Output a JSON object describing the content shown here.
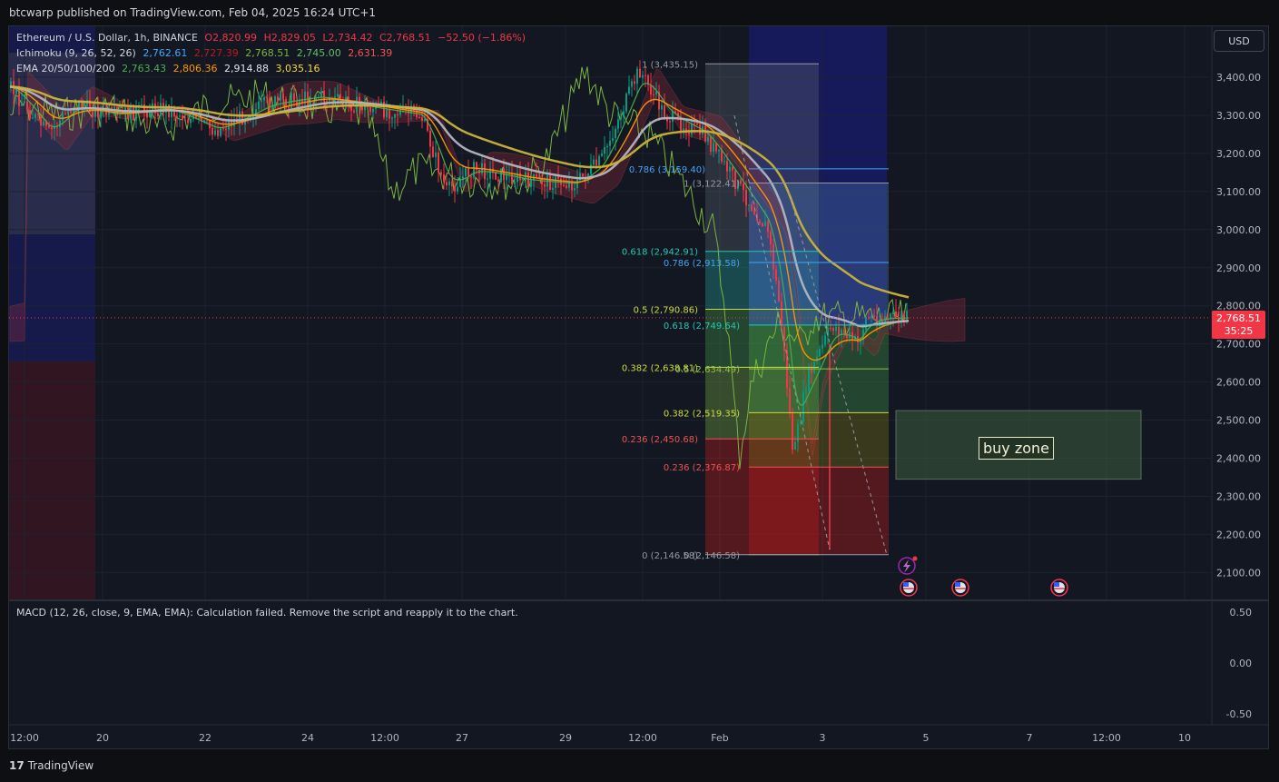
{
  "header": {
    "publisher_line": "btcwarp published on TradingView.com, Feb 04, 2025 16:24 UTC+1"
  },
  "legend": {
    "symbol": "Ethereum / U.S. Dollar, 1h, BINANCE",
    "ohlc": {
      "o": "O2,820.99",
      "h": "H2,829.05",
      "l": "L2,734.42",
      "c": "C2,768.51",
      "chg": "−52.50 (−1.86%)"
    },
    "ichimoku": {
      "label": "Ichimoku (9, 26, 52, 26)",
      "v1": "2,762.61",
      "v2": "2,727.39",
      "v3": "2,768.51",
      "v4": "2,745.00",
      "v5": "2,631.39"
    },
    "ema": {
      "label": "EMA 20/50/100/200",
      "v20": "2,763.43",
      "v50": "2,806.36",
      "v100": "2,914.88",
      "v200": "3,035.16"
    }
  },
  "currency_button": "USD",
  "last_price": {
    "price": "2,768.51",
    "countdown": "35:25"
  },
  "annotations": {
    "buy_zone": "buy zone"
  },
  "macd_message": "MACD (12, 26, close, 9, EMA, EMA): Calculation failed. Remove the script and reapply it to the chart.",
  "branding": "TradingView",
  "colors": {
    "up": "#089981",
    "down": "#f23645",
    "ema20": "#4caf50",
    "ema50": "#ff9800",
    "ema100": "#b2b5be",
    "ema200": "#c9b33a",
    "fib_teal": "#26c6b0",
    "fib_blue": "#42a5f5",
    "fib_yellow": "#cddc39",
    "fib_red": "#ef5350"
  },
  "chart_data": {
    "type": "candlestick",
    "title": "Ethereum / U.S. Dollar, 1h, BINANCE",
    "ylabel": "USD",
    "ylim": [
      2050,
      3480
    ],
    "y_ticks": [
      "3,400.00",
      "3,300.00",
      "3,200.00",
      "3,100.00",
      "3,000.00",
      "2,900.00",
      "2,800.00",
      "2,700.00",
      "2,600.00",
      "2,500.00",
      "2,400.00",
      "2,300.00",
      "2,200.00",
      "2,100.00"
    ],
    "x_ticks": [
      "12:00",
      "20",
      "22",
      "24",
      "12:00",
      "27",
      "29",
      "12:00",
      "Feb",
      "3",
      "5",
      "7",
      "12:00",
      "10"
    ],
    "price_path": [
      [
        "Jan 19 00:00",
        3375
      ],
      [
        "Jan 19 18:00",
        3250
      ],
      [
        "Jan 20 06:00",
        3330
      ],
      [
        "Jan 21 00:00",
        3300
      ],
      [
        "Jan 22 00:00",
        3320
      ],
      [
        "Jan 23 00:00",
        3260
      ],
      [
        "Jan 24 00:00",
        3330
      ],
      [
        "Jan 25 00:00",
        3350
      ],
      [
        "Jan 26 00:00",
        3320
      ],
      [
        "Jan 27 00:00",
        3300
      ],
      [
        "Jan 27 12:00",
        3100
      ],
      [
        "Jan 28 00:00",
        3160
      ],
      [
        "Jan 29 00:00",
        3130
      ],
      [
        "Jan 30 00:00",
        3120
      ],
      [
        "Jan 30 12:00",
        3180
      ],
      [
        "Jan 31 06:00",
        3420
      ],
      [
        "Jan 31 18:00",
        3300
      ],
      [
        "Feb 01 12:00",
        3250
      ],
      [
        "Feb 02 00:00",
        3150
      ],
      [
        "Feb 02 18:00",
        3000
      ],
      [
        "Feb 03 00:00",
        2780
      ],
      [
        "Feb 03 06:00",
        2400
      ],
      [
        "Feb 03 12:00",
        2600
      ],
      [
        "Feb 04 00:00",
        2750
      ],
      [
        "Feb 04 12:00",
        2700
      ],
      [
        "Feb 04 16:00",
        2768.51
      ]
    ],
    "ema": [
      {
        "name": "EMA 20",
        "last": 2763.43
      },
      {
        "name": "EMA 50",
        "last": 2806.36
      },
      {
        "name": "EMA 100",
        "last": 2914.88
      },
      {
        "name": "EMA 200",
        "last": 3035.16
      }
    ],
    "fib_retracement_1": {
      "levels": [
        {
          "label": "1 (3,435.15)",
          "value": 3435.15
        },
        {
          "label": "0.618 (2,942.91)",
          "value": 2942.91
        },
        {
          "label": "0.5 (2,790.86)",
          "value": 2790.86
        },
        {
          "label": "0.382 (2,638.81)",
          "value": 2638.81
        },
        {
          "label": "0.236 (2,450.68)",
          "value": 2450.68
        },
        {
          "label": "0 (2,146.58)",
          "value": 2146.58
        }
      ]
    },
    "fib_retracement_2": {
      "levels": [
        {
          "label": "0.786 (3,159.40)",
          "value": 3159.4
        },
        {
          "label": "1 (3,122.41)",
          "value": 3122.41
        },
        {
          "label": "0.786 (2,913.58)",
          "value": 2913.58
        },
        {
          "label": "0.618 (2,749.64)",
          "value": 2749.64
        },
        {
          "label": "0.5 (2,634.49)",
          "value": 2634.49
        },
        {
          "label": "0.382 (2,519.35)",
          "value": 2519.35
        },
        {
          "label": "0.236 (2,376.87)",
          "value": 2376.87
        },
        {
          "label": "0 (2,146.58)",
          "value": 2146.58
        }
      ]
    },
    "buy_zone": {
      "label": "buy zone",
      "top": 2525,
      "bottom": 2345
    },
    "last_price": 2768.51,
    "macd": {
      "y_ticks": [
        "0.50",
        "0.00",
        "-0.50"
      ],
      "status": "Calculation failed"
    }
  }
}
